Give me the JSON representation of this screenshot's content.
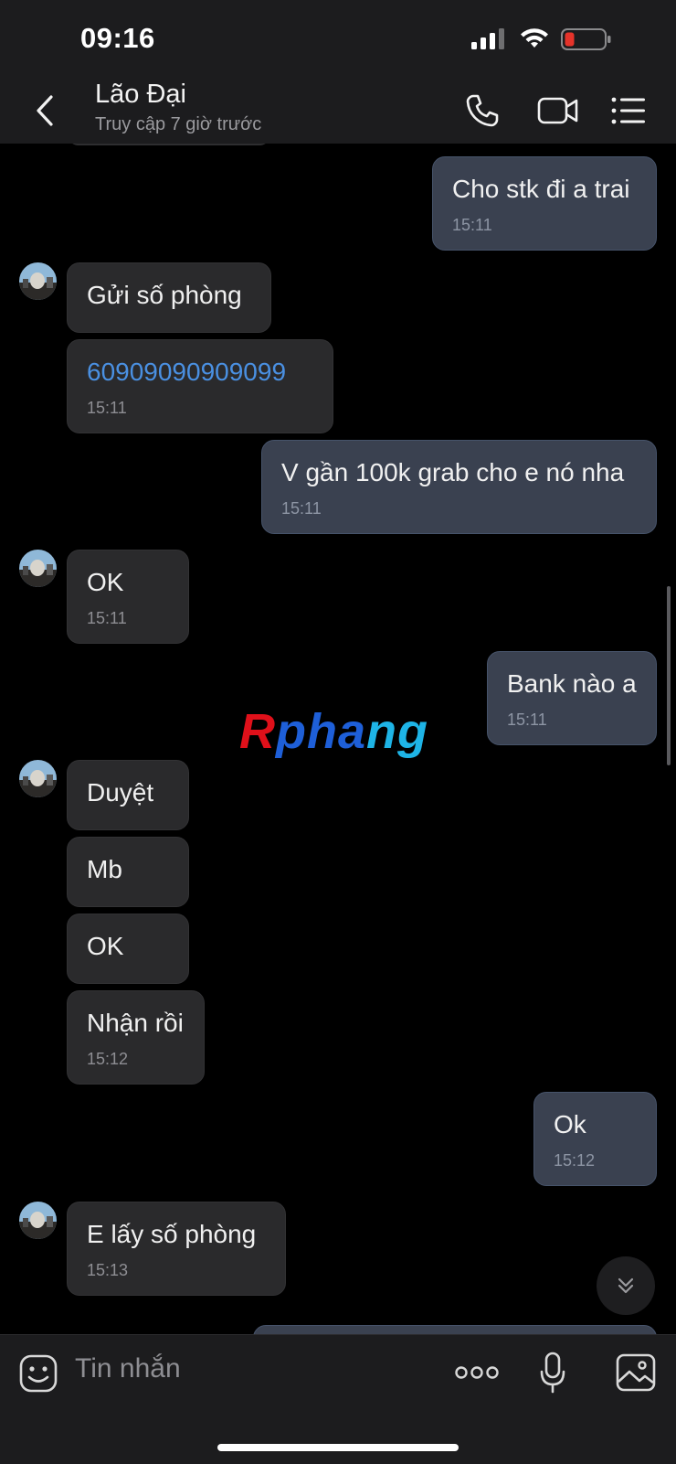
{
  "status_bar": {
    "time": "09:16"
  },
  "header": {
    "name": "Lão Đại",
    "status": "Truy cập 7 giờ trước"
  },
  "messages": [
    {
      "dir": "out",
      "text": "Cho stk đi a trai",
      "time": "15:11"
    },
    {
      "dir": "in",
      "text": "Gửi số phòng",
      "time": ""
    },
    {
      "dir": "in",
      "text": "60909090909099",
      "time": "15:11",
      "link": true
    },
    {
      "dir": "out",
      "text": "V gần 100k grab cho e nó nha",
      "time": "15:11"
    },
    {
      "dir": "in",
      "text": "OK",
      "time": "15:11"
    },
    {
      "dir": "out",
      "text": "Bank nào a",
      "time": "15:11"
    },
    {
      "dir": "in",
      "text": "Duyệt",
      "time": ""
    },
    {
      "dir": "in",
      "text": "Mb",
      "time": ""
    },
    {
      "dir": "in",
      "text": "OK",
      "time": ""
    },
    {
      "dir": "in",
      "text": "Nhận rồi",
      "time": "15:12"
    },
    {
      "dir": "out",
      "text": "Ok",
      "time": "15:12"
    },
    {
      "dir": "in",
      "text": "E lấy số phòng",
      "time": "15:13"
    }
  ],
  "watermark": {
    "part1": "R",
    "part2": "pha",
    "part3": "ng"
  },
  "input": {
    "placeholder": "Tin nhắn"
  },
  "colors": {
    "incoming_bubble": "#2a2a2c",
    "outgoing_bubble": "#3a4150",
    "link": "#4a90e2",
    "background": "#000000"
  },
  "icons": [
    "back-icon",
    "phone-icon",
    "video-icon",
    "menu-icon",
    "emoji-icon",
    "more-icon",
    "microphone-icon",
    "image-icon",
    "scroll-down-icon"
  ]
}
